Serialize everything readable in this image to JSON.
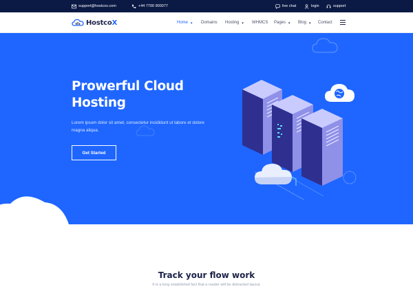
{
  "topbar": {
    "email": "support@hostcox.com",
    "phone": "+44 7700 900077",
    "live_chat": "live chat",
    "login": "login",
    "support": "support"
  },
  "brand": {
    "name_main": "Hostco",
    "name_accent": "X"
  },
  "nav": {
    "items": [
      {
        "label": "Home",
        "active": true,
        "dropdown": true
      },
      {
        "label": "Domains",
        "active": false,
        "dropdown": false
      },
      {
        "label": "Hosting",
        "active": false,
        "dropdown": true
      },
      {
        "label": "WHMCS",
        "active": false,
        "dropdown": false
      },
      {
        "label": "Pages",
        "active": false,
        "dropdown": true
      },
      {
        "label": "Blog",
        "active": false,
        "dropdown": true
      },
      {
        "label": "Contact",
        "active": false,
        "dropdown": false
      }
    ],
    "menu_icon": "hamburger-icon"
  },
  "hero": {
    "title_line1": "Prowerful Cloud",
    "title_line2": "Hosting",
    "subtitle": "Lorem ipsum dolor sit amet, consectetur incididunt ut labore et dolore magna aliqua.",
    "cta_label": "Get Started"
  },
  "section": {
    "title": "Track your flow work",
    "subtitle": "It is a long established fact that a reader will be distracted layout."
  },
  "colors": {
    "topbar": "#0b1a45",
    "hero": "#1e66ff",
    "accent": "#1e66ff",
    "text_dark": "#1b2248"
  }
}
